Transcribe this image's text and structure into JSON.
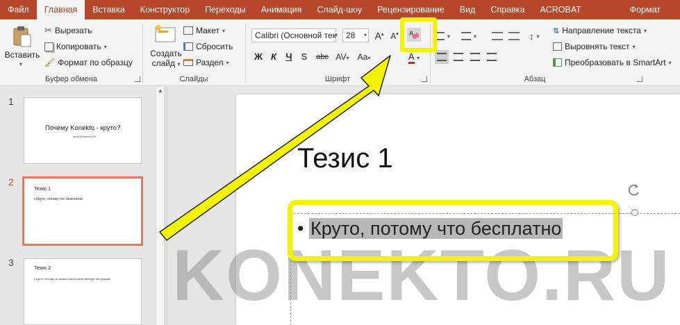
{
  "tabs": [
    "Файл",
    "Главная",
    "Вставка",
    "Конструктор",
    "Переходы",
    "Анимация",
    "Слайд-шоу",
    "Рецензирование",
    "Вид",
    "Справка",
    "ACROBAT",
    "Формат"
  ],
  "active_tab": "Главная",
  "ribbon": {
    "clipboard": {
      "paste": "Вставить",
      "cut": "Вырезать",
      "copy": "Копировать",
      "format_painter": "Формат по образцу",
      "group": "Буфер обмена"
    },
    "slides": {
      "new_slide": "Создать",
      "new_slide_2": "слайд",
      "layout": "Макет",
      "reset": "Сбросить",
      "section": "Раздел",
      "group": "Слайды"
    },
    "font": {
      "font_name": "Calibri (Основной тек",
      "font_size": "28",
      "bold": "Ж",
      "italic": "К",
      "underline": "Ч",
      "strike": "S",
      "shadow": "abc",
      "spacing": "AV",
      "case": "Aa",
      "group": "Шрифт"
    },
    "paragraph": {
      "group": "Абзац",
      "text_direction": "Направление текста",
      "align_text": "Выровнять текст",
      "smartart": "Преобразовать в SmartArt"
    }
  },
  "slides": [
    {
      "num": "1",
      "title": "Почему Konekto - круто?",
      "sub": "Автор Юлианна Ю.В."
    },
    {
      "num": "2",
      "title": "Тезис 1",
      "body": "• Круто, потому что бесплатно"
    },
    {
      "num": "3",
      "title": "Тезис 2",
      "body": "• Круто, потому что можно найти качественную инструкцию"
    }
  ],
  "current_slide": {
    "title": "Тезис 1",
    "bullet": "•",
    "body": "Круто, потому что бесплатно"
  },
  "watermark": "KONEKTO.RU",
  "colors": {
    "accent": "#b7472a",
    "highlight": "#f5f400"
  }
}
